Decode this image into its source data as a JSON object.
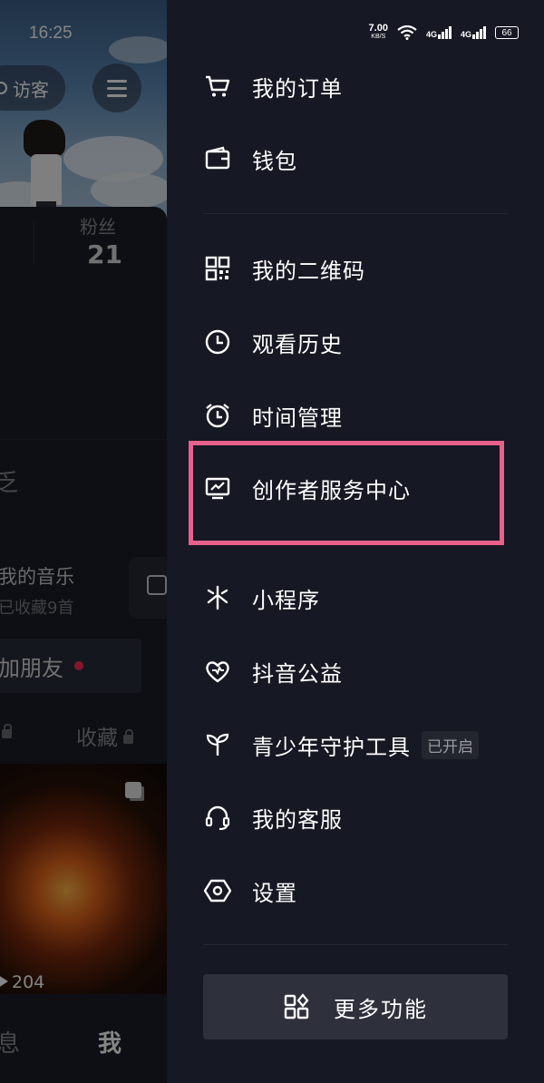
{
  "status_bar": {
    "time": "16:25",
    "net_speed": "7.00",
    "net_unit": "KB/S",
    "signal1": "4G",
    "signal2": "4G",
    "battery": "66"
  },
  "profile": {
    "visitor_label": "访客",
    "fans_label": "粉丝",
    "fans_count": "21",
    "fragment_char": "乏",
    "music_title": "我的音乐",
    "music_sub": "已收藏9首",
    "add_friend": "加朋友",
    "favorites_tab": "收藏",
    "play_count": "204",
    "nav_message": "息",
    "nav_me": "我"
  },
  "drawer": {
    "items": [
      {
        "label": "我的订单",
        "icon": "cart-icon"
      },
      {
        "label": "钱包",
        "icon": "wallet-icon"
      },
      {
        "label": "我的二维码",
        "icon": "qrcode-icon"
      },
      {
        "label": "观看历史",
        "icon": "clock-icon"
      },
      {
        "label": "时间管理",
        "icon": "alarm-icon"
      },
      {
        "label": "创作者服务中心",
        "icon": "creator-chart-icon"
      },
      {
        "label": "小程序",
        "icon": "mini-program-icon"
      },
      {
        "label": "抖音公益",
        "icon": "charity-heart-icon"
      },
      {
        "label": "青少年守护工具",
        "icon": "sprout-icon",
        "badge": "已开启"
      },
      {
        "label": "我的客服",
        "icon": "headset-icon"
      },
      {
        "label": "设置",
        "icon": "settings-icon"
      }
    ],
    "more_button": "更多功能"
  },
  "colors": {
    "background": "#161823",
    "highlight_border": "#e8618c",
    "notification_dot": "#fe2c55"
  }
}
